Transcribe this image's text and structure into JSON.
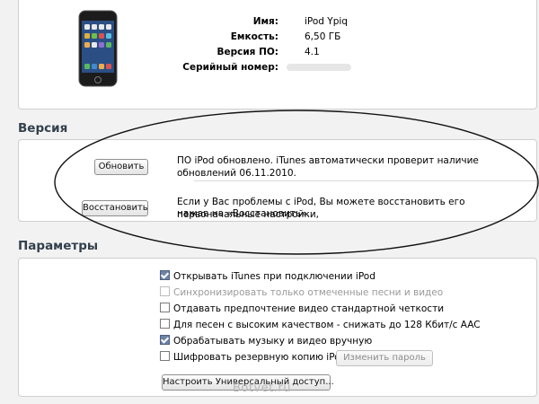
{
  "device": {
    "icon": "ipod-touch-icon",
    "fields": [
      {
        "label": "Имя:",
        "value": "iPod Ypiq"
      },
      {
        "label": "Емкость:",
        "value": "6,50 ГБ"
      },
      {
        "label": "Версия ПО:",
        "value": "4.1"
      },
      {
        "label": "Серийный номер:",
        "value": ""
      }
    ]
  },
  "version": {
    "title": "Версия",
    "update_button": "Обновить",
    "update_text": "ПО iPod обновлено. iTunes автоматически проверит наличие обновлений 06.11.2010.",
    "restore_button": "Восстановить",
    "restore_text_line1": "Если у Вас проблемы с iPod, Вы можете восстановить его первоначальные настройки,",
    "restore_text_line2": "нажав на «Восстановить»."
  },
  "params": {
    "title": "Параметры",
    "options": [
      {
        "label": "Открывать iTunes при подключении iPod",
        "checked": true,
        "disabled": false
      },
      {
        "label": "Синхронизировать только отмеченные песни и видео",
        "checked": false,
        "disabled": true
      },
      {
        "label": "Отдавать предпочтение видео стандартной четкости",
        "checked": false,
        "disabled": false
      },
      {
        "label": "Для песен с высоким качеством - снижать до 128 Кбит/с AAC",
        "checked": false,
        "disabled": false
      },
      {
        "label": "Обрабатывать музыку и видео вручную",
        "checked": true,
        "disabled": false
      },
      {
        "label": "Шифровать резервную копию iPod",
        "checked": false,
        "disabled": false
      }
    ],
    "change_password_button": "Изменить пароль",
    "universal_access_button": "Настроить Универсальный доступ..."
  },
  "watermark": "Botvet.ru",
  "colors": {
    "section_title": "#33404d",
    "checkbox_checked": "#6e83a8",
    "background": "#f2f2f2"
  }
}
